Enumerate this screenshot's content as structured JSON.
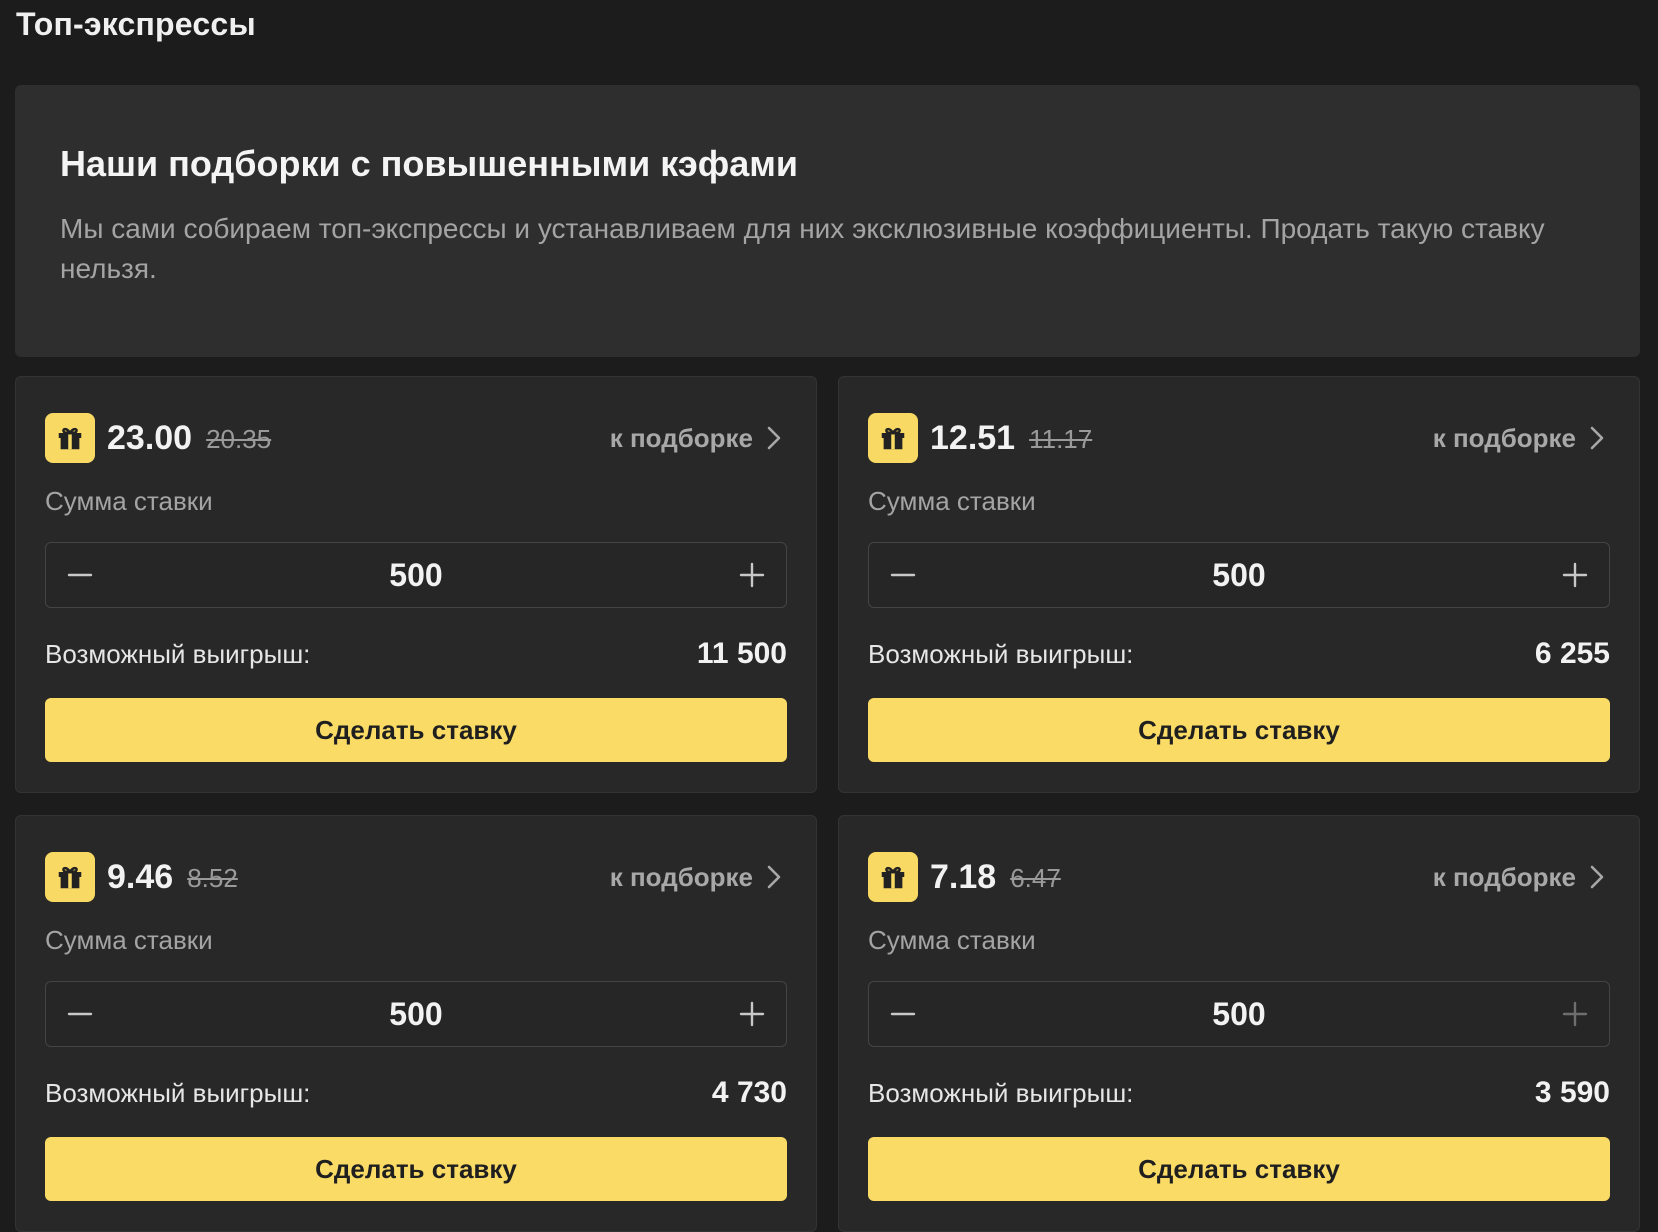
{
  "page": {
    "title": "Топ-экспрессы"
  },
  "intro": {
    "heading": "Наши подборки с повышенными кэфами",
    "text": "Мы сами собираем топ-экспрессы и устанавливаем для них эксклюзивные коэффициенты. Продать такую ставку нельзя."
  },
  "colors": {
    "accent": "#f9db66",
    "card_bg": "#282828",
    "page_bg": "#1c1c1c"
  },
  "cards": [
    {
      "icon": "gift-icon",
      "odds_new": "23.00",
      "odds_old": "20.35",
      "link_label": "к подборке",
      "stake_label": "Сумма ставки",
      "stake_value": "500",
      "win_label": "Возможный выигрыш:",
      "win_value": "11 500",
      "bet_label": "Сделать ставку"
    },
    {
      "icon": "gift-icon",
      "odds_new": "12.51",
      "odds_old": "11.17",
      "link_label": "к подборке",
      "stake_label": "Сумма ставки",
      "stake_value": "500",
      "win_label": "Возможный выигрыш:",
      "win_value": "6 255",
      "bet_label": "Сделать ставку"
    },
    {
      "icon": "gift-icon",
      "odds_new": "9.46",
      "odds_old": "8.52",
      "link_label": "к подборке",
      "stake_label": "Сумма ставки",
      "stake_value": "500",
      "win_label": "Возможный выигрыш:",
      "win_value": "4 730",
      "bet_label": "Сделать ставку"
    },
    {
      "icon": "gift-icon",
      "odds_new": "7.18",
      "odds_old": "6.47",
      "link_label": "к подборке",
      "stake_label": "Сумма ставки",
      "stake_value": "500",
      "win_label": "Возможный выигрыш:",
      "win_value": "3 590",
      "bet_label": "Сделать ставку"
    }
  ]
}
